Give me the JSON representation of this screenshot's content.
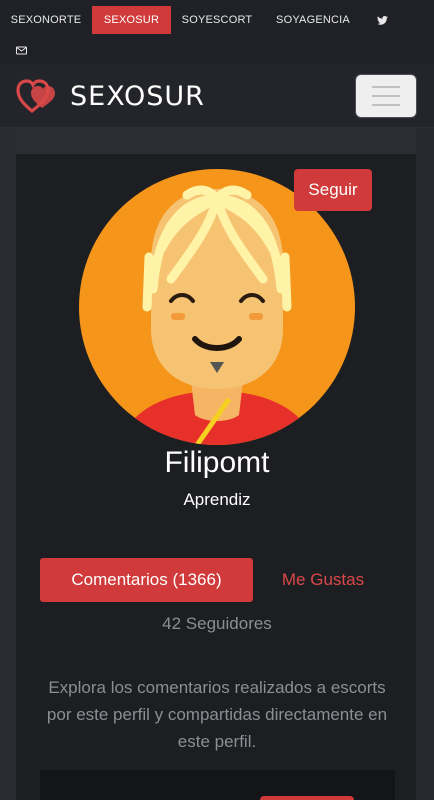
{
  "topnav": {
    "links": [
      "SEXONORTE",
      "SEXOSUR",
      "SOYESCORT",
      "SOYAGENCIA"
    ],
    "active_index": 1,
    "icons": [
      "twitter-icon",
      "envelope-icon"
    ]
  },
  "navbar": {
    "logo_text": "SEXOSUR",
    "menu_icon": "hamburger-menu-icon"
  },
  "profile": {
    "follow_label": "Seguir",
    "username": "Filipomt",
    "rank": "Aprendiz",
    "tabs": [
      {
        "label": "Comentarios (1366)",
        "active": true
      },
      {
        "label": "Me Gustas",
        "active": false
      }
    ],
    "followers": "42 Seguidores",
    "description": "Explora los comentarios realizados a escorts por este perfil y compartidas directamente en este perfil."
  },
  "colors": {
    "accent": "#d13a3a",
    "background": "#1d1f24",
    "card": "#1c1e22",
    "muted_text": "#8c8e93"
  }
}
